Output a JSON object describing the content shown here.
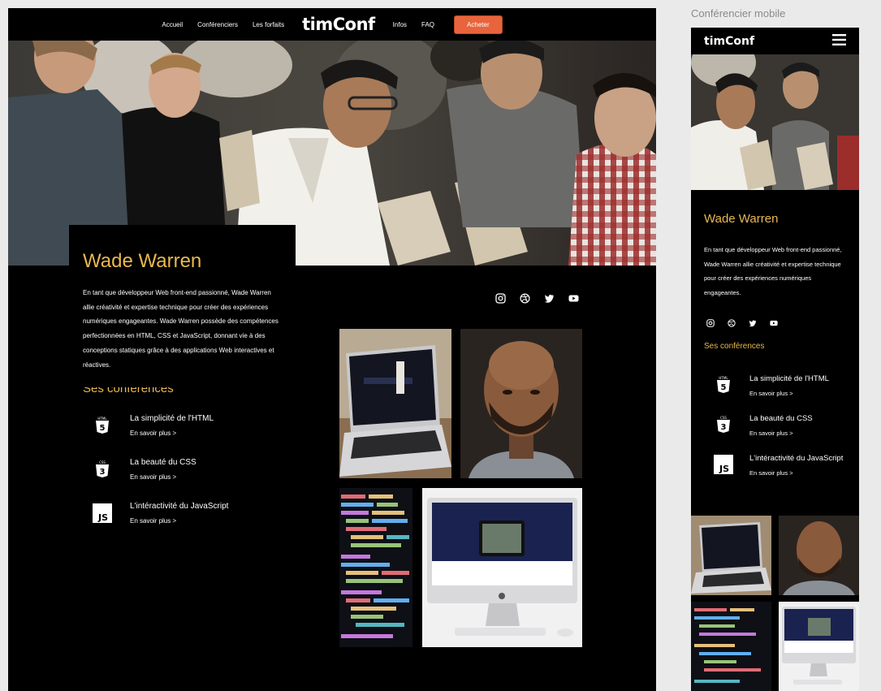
{
  "nav": {
    "links": [
      "Accueil",
      "Conférenciers",
      "Les forfaits"
    ],
    "logo": "timConf",
    "links_right": [
      "Infos",
      "FAQ"
    ],
    "cta": "Acheter"
  },
  "speaker": {
    "name": "Wade Warren",
    "bio": "En tant que développeur Web front-end passionné, Wade Warren allie créativité et expertise technique pour créer des expériences numériques engageantes.  Wade Warren possède des compétences perfectionnées en HTML, CSS et JavaScript, donnant vie à des conceptions statiques grâce à des applications Web interactives et réactives.",
    "talks_title": "Ses conférences",
    "talks": [
      {
        "title": "La simplicité de l'HTML",
        "more": "En savoir plus >",
        "icon": "html5-icon"
      },
      {
        "title": "La beauté du CSS",
        "more": "En savoir plus >",
        "icon": "css3-icon"
      },
      {
        "title": "L'intéractivité du JavaScript",
        "more": "En savoir plus >",
        "icon": "javascript-icon"
      }
    ],
    "social": [
      "instagram-icon",
      "dribbble-icon",
      "twitter-icon",
      "youtube-icon"
    ]
  },
  "mobile": {
    "label": "Conférencier mobile",
    "logo": "timConf",
    "name": "Wade Warren",
    "bio": "En tant que développeur Web front-end passionné, Wade Warren allie créativité et expertise technique pour créer des expériences numériques engageantes.",
    "talks_title": "Ses conférences",
    "talks": [
      {
        "title": "La simplicité de l'HTML",
        "more": "En savoir plus >"
      },
      {
        "title": "La beauté du CSS",
        "more": "En savoir plus >"
      },
      {
        "title": "L'intéractivité du JavaScript",
        "more": "En savoir plus >"
      }
    ]
  },
  "colors": {
    "accent": "#e9b84f",
    "cta": "#e8643c",
    "background": "#000000"
  }
}
